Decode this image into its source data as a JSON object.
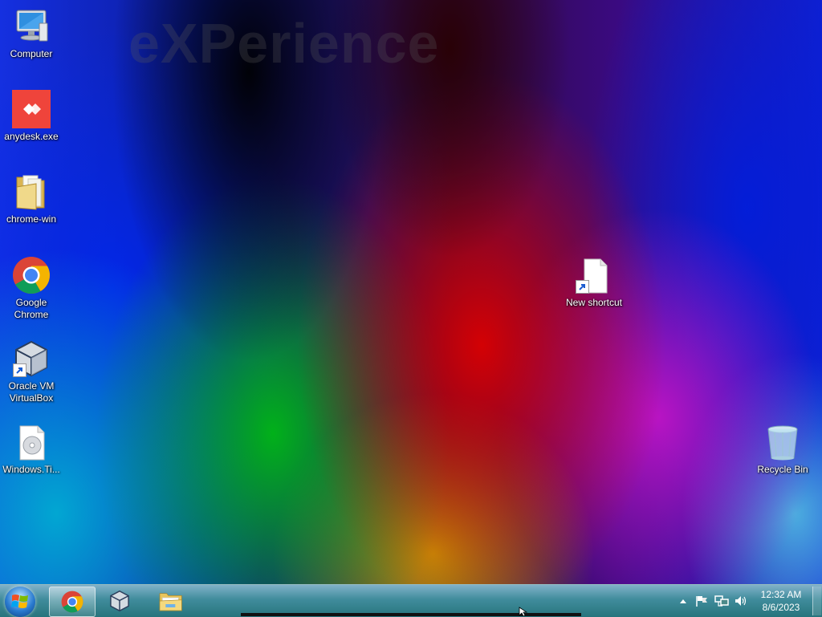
{
  "desktop": {
    "watermark": "eXPerience",
    "icons": [
      {
        "label": "Computer",
        "icon": "computer-icon"
      },
      {
        "label": "anydesk.exe",
        "icon": "anydesk-icon"
      },
      {
        "label": "chrome-win",
        "icon": "folder-icon"
      },
      {
        "label": "Google Chrome",
        "icon": "chrome-icon"
      },
      {
        "label": "Oracle VM VirtualBox",
        "icon": "virtualbox-icon"
      },
      {
        "label": "Windows.Ti...",
        "icon": "disc-image-icon"
      },
      {
        "label": "New shortcut",
        "icon": "blank-file-icon"
      },
      {
        "label": "Recycle Bin",
        "icon": "recycle-bin-icon"
      }
    ]
  },
  "taskbar": {
    "pinned": [
      "chrome-icon",
      "virtualbox-icon",
      "file-explorer-icon"
    ],
    "active_item": "chrome-icon",
    "tray": [
      "show-hidden-icons",
      "action-center-flag-icon",
      "network-icon",
      "volume-icon"
    ],
    "clock": {
      "time": "12:32 AM",
      "date": "8/6/2023"
    }
  }
}
